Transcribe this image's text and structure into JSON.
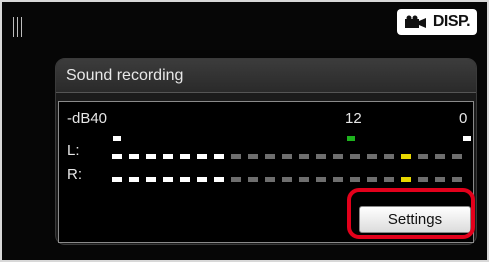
{
  "header": {
    "disp_label": "DISP.",
    "disp_icon": "movie-camera-icon"
  },
  "panel": {
    "title": "Sound recording"
  },
  "meter": {
    "scale_labels": [
      "-dB40",
      "12",
      "0"
    ],
    "markers": [
      {
        "position_label": "-dB40",
        "color": "#ffffff"
      },
      {
        "position_label": "12",
        "color": "#1db31d"
      },
      {
        "position_label": "0",
        "color": "#ffffff"
      }
    ],
    "channels": [
      {
        "label": "L:",
        "lit_segments": 7,
        "peak_segment": 17
      },
      {
        "label": "R:",
        "lit_segments": 7,
        "peak_segment": 17
      }
    ],
    "total_segments": 21,
    "colors": {
      "lit": "#ffffff",
      "unlit": "#6e6e6e",
      "peak": "#e8d800"
    }
  },
  "settings_button": {
    "label": "Settings"
  },
  "highlight_color": "#e3001b"
}
